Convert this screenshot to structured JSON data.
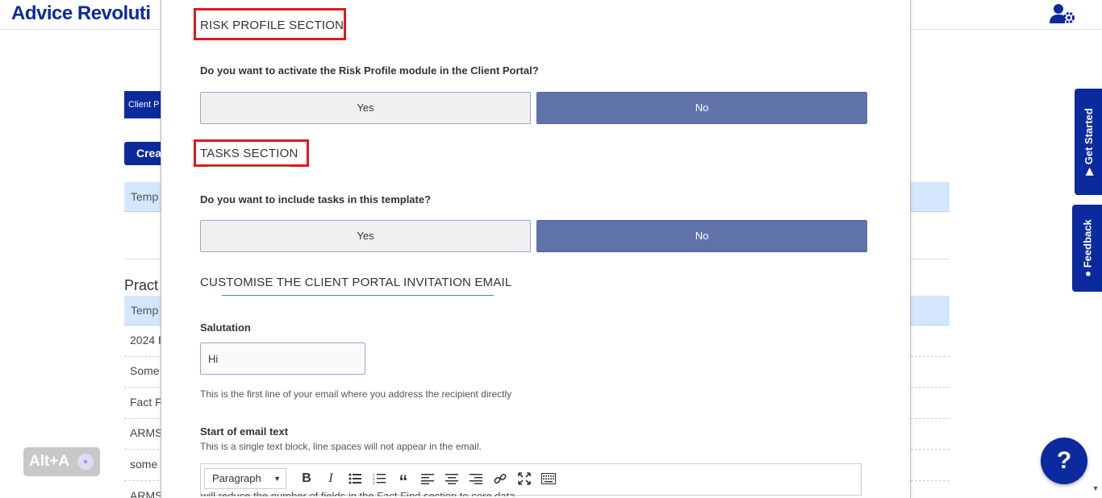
{
  "app": {
    "brand": "Advice Revoluti"
  },
  "background": {
    "chip_label": "Client P",
    "create_label": "Crea",
    "table1_header": "Temp",
    "section_heading": "Pract",
    "table2_header": "Temp",
    "rows": [
      "2024 F",
      "Some",
      "Fact F",
      "ARMS",
      "some",
      "ARMS"
    ]
  },
  "modal": {
    "risk_section_title": "RISK PROFILE SECTION",
    "risk_question": "Do you want to activate the Risk Profile module in the Client Portal?",
    "risk_yes": "Yes",
    "risk_no": "No",
    "tasks_section_title": "TASKS SECTION",
    "tasks_question": "Do you want to include tasks in this template?",
    "tasks_yes": "Yes",
    "tasks_no": "No",
    "email_section_title": "CUSTOMISE THE CLIENT PORTAL INVITATION EMAIL",
    "salutation_label": "Salutation",
    "salutation_value": "Hi",
    "salutation_hint": "This is the first line of your email where you address the recipient directly",
    "start_text_label": "Start of email text",
    "start_text_hint": "This is a single text block, line spaces will not appear in the email.",
    "editor": {
      "paragraph_select": "Paragraph",
      "tools": [
        "bold-icon",
        "italic-icon",
        "bullet-list-icon",
        "numbered-list-icon",
        "blockquote-icon",
        "align-left-icon",
        "align-center-icon",
        "align-right-icon",
        "link-icon",
        "fullscreen-icon",
        "source-code-icon"
      ],
      "partial_text": "will reduce the number of fields in the Fact Find section to core data"
    }
  },
  "widgets": {
    "alt_a": "Alt+A",
    "get_started": "Get Started",
    "feedback": "Feedback",
    "help": "?"
  },
  "colors": {
    "brand": "#0b2a9e",
    "no_button": "#6073a8",
    "highlight_red": "#e0181e",
    "underline_green": "#2aa55a",
    "table_header": "#d4e6fb"
  }
}
